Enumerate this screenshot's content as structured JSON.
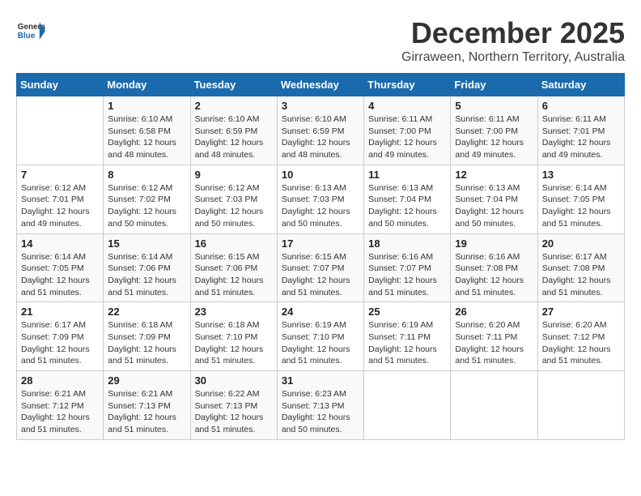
{
  "logo": {
    "general": "General",
    "blue": "Blue"
  },
  "title": "December 2025",
  "subtitle": "Girraween, Northern Territory, Australia",
  "days_of_week": [
    "Sunday",
    "Monday",
    "Tuesday",
    "Wednesday",
    "Thursday",
    "Friday",
    "Saturday"
  ],
  "weeks": [
    [
      {
        "day": "",
        "info": ""
      },
      {
        "day": "1",
        "info": "Sunrise: 6:10 AM\nSunset: 6:58 PM\nDaylight: 12 hours\nand 48 minutes."
      },
      {
        "day": "2",
        "info": "Sunrise: 6:10 AM\nSunset: 6:59 PM\nDaylight: 12 hours\nand 48 minutes."
      },
      {
        "day": "3",
        "info": "Sunrise: 6:10 AM\nSunset: 6:59 PM\nDaylight: 12 hours\nand 48 minutes."
      },
      {
        "day": "4",
        "info": "Sunrise: 6:11 AM\nSunset: 7:00 PM\nDaylight: 12 hours\nand 49 minutes."
      },
      {
        "day": "5",
        "info": "Sunrise: 6:11 AM\nSunset: 7:00 PM\nDaylight: 12 hours\nand 49 minutes."
      },
      {
        "day": "6",
        "info": "Sunrise: 6:11 AM\nSunset: 7:01 PM\nDaylight: 12 hours\nand 49 minutes."
      }
    ],
    [
      {
        "day": "7",
        "info": "Sunrise: 6:12 AM\nSunset: 7:01 PM\nDaylight: 12 hours\nand 49 minutes."
      },
      {
        "day": "8",
        "info": "Sunrise: 6:12 AM\nSunset: 7:02 PM\nDaylight: 12 hours\nand 50 minutes."
      },
      {
        "day": "9",
        "info": "Sunrise: 6:12 AM\nSunset: 7:03 PM\nDaylight: 12 hours\nand 50 minutes."
      },
      {
        "day": "10",
        "info": "Sunrise: 6:13 AM\nSunset: 7:03 PM\nDaylight: 12 hours\nand 50 minutes."
      },
      {
        "day": "11",
        "info": "Sunrise: 6:13 AM\nSunset: 7:04 PM\nDaylight: 12 hours\nand 50 minutes."
      },
      {
        "day": "12",
        "info": "Sunrise: 6:13 AM\nSunset: 7:04 PM\nDaylight: 12 hours\nand 50 minutes."
      },
      {
        "day": "13",
        "info": "Sunrise: 6:14 AM\nSunset: 7:05 PM\nDaylight: 12 hours\nand 51 minutes."
      }
    ],
    [
      {
        "day": "14",
        "info": "Sunrise: 6:14 AM\nSunset: 7:05 PM\nDaylight: 12 hours\nand 51 minutes."
      },
      {
        "day": "15",
        "info": "Sunrise: 6:14 AM\nSunset: 7:06 PM\nDaylight: 12 hours\nand 51 minutes."
      },
      {
        "day": "16",
        "info": "Sunrise: 6:15 AM\nSunset: 7:06 PM\nDaylight: 12 hours\nand 51 minutes."
      },
      {
        "day": "17",
        "info": "Sunrise: 6:15 AM\nSunset: 7:07 PM\nDaylight: 12 hours\nand 51 minutes."
      },
      {
        "day": "18",
        "info": "Sunrise: 6:16 AM\nSunset: 7:07 PM\nDaylight: 12 hours\nand 51 minutes."
      },
      {
        "day": "19",
        "info": "Sunrise: 6:16 AM\nSunset: 7:08 PM\nDaylight: 12 hours\nand 51 minutes."
      },
      {
        "day": "20",
        "info": "Sunrise: 6:17 AM\nSunset: 7:08 PM\nDaylight: 12 hours\nand 51 minutes."
      }
    ],
    [
      {
        "day": "21",
        "info": "Sunrise: 6:17 AM\nSunset: 7:09 PM\nDaylight: 12 hours\nand 51 minutes."
      },
      {
        "day": "22",
        "info": "Sunrise: 6:18 AM\nSunset: 7:09 PM\nDaylight: 12 hours\nand 51 minutes."
      },
      {
        "day": "23",
        "info": "Sunrise: 6:18 AM\nSunset: 7:10 PM\nDaylight: 12 hours\nand 51 minutes."
      },
      {
        "day": "24",
        "info": "Sunrise: 6:19 AM\nSunset: 7:10 PM\nDaylight: 12 hours\nand 51 minutes."
      },
      {
        "day": "25",
        "info": "Sunrise: 6:19 AM\nSunset: 7:11 PM\nDaylight: 12 hours\nand 51 minutes."
      },
      {
        "day": "26",
        "info": "Sunrise: 6:20 AM\nSunset: 7:11 PM\nDaylight: 12 hours\nand 51 minutes."
      },
      {
        "day": "27",
        "info": "Sunrise: 6:20 AM\nSunset: 7:12 PM\nDaylight: 12 hours\nand 51 minutes."
      }
    ],
    [
      {
        "day": "28",
        "info": "Sunrise: 6:21 AM\nSunset: 7:12 PM\nDaylight: 12 hours\nand 51 minutes."
      },
      {
        "day": "29",
        "info": "Sunrise: 6:21 AM\nSunset: 7:13 PM\nDaylight: 12 hours\nand 51 minutes."
      },
      {
        "day": "30",
        "info": "Sunrise: 6:22 AM\nSunset: 7:13 PM\nDaylight: 12 hours\nand 51 minutes."
      },
      {
        "day": "31",
        "info": "Sunrise: 6:23 AM\nSunset: 7:13 PM\nDaylight: 12 hours\nand 50 minutes."
      },
      {
        "day": "",
        "info": ""
      },
      {
        "day": "",
        "info": ""
      },
      {
        "day": "",
        "info": ""
      }
    ]
  ]
}
